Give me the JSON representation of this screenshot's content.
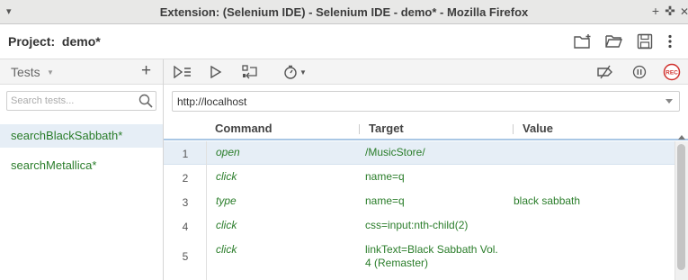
{
  "window": {
    "title": "Extension: (Selenium IDE) - Selenium IDE - demo* - Mozilla Firefox",
    "menu_glyph": "▾",
    "minimize_glyph": "+",
    "maximize_glyph": "✜",
    "close_glyph": "✕"
  },
  "project": {
    "label": "Project:",
    "name": "demo*"
  },
  "sidebar": {
    "header": "Tests",
    "add_glyph": "+",
    "search_placeholder": "Search tests...",
    "tests": [
      {
        "name": "searchBlackSabbath*",
        "selected": true
      },
      {
        "name": "searchMetallica*",
        "selected": false
      }
    ]
  },
  "toolbar": {
    "rec_label": "REC"
  },
  "url": {
    "value": "http://localhost"
  },
  "table": {
    "headers": {
      "command": "Command",
      "target": "Target",
      "value": "Value"
    },
    "rows": [
      {
        "num": "1",
        "command": "open",
        "target": "/MusicStore/",
        "value": ""
      },
      {
        "num": "2",
        "command": "click",
        "target": "name=q",
        "value": ""
      },
      {
        "num": "3",
        "command": "type",
        "target": "name=q",
        "value": "black sabbath"
      },
      {
        "num": "4",
        "command": "click",
        "target": "css=input:nth-child(2)",
        "value": ""
      },
      {
        "num": "5",
        "command": "click",
        "target": "linkText=Black Sabbath Vol. 4 (Remaster)",
        "value": ""
      }
    ]
  },
  "colors": {
    "accent_green": "#2a7d2a",
    "selection": "#e6eef6",
    "rec_red": "#d0312d"
  }
}
